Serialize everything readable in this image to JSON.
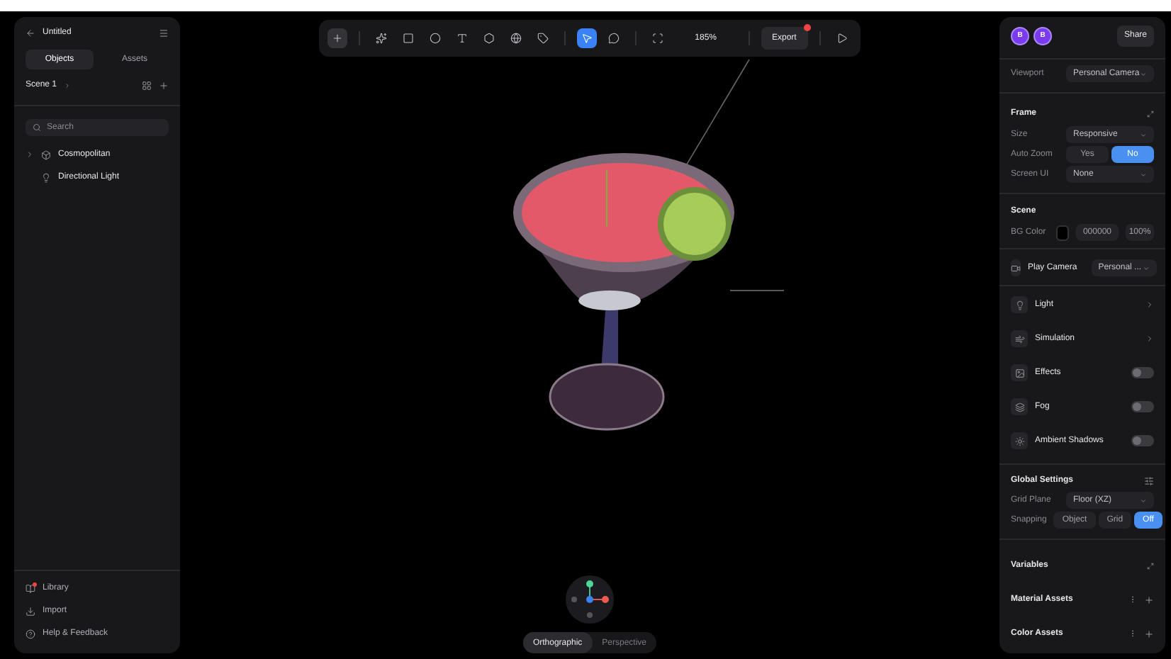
{
  "left_panel": {
    "title": "Untitled",
    "tabs": [
      {
        "label": "Objects",
        "selected": true
      },
      {
        "label": "Assets",
        "selected": false
      }
    ],
    "scene": "Scene 1",
    "search": {
      "placeholder": "Search"
    },
    "tree": [
      {
        "label": "Cosmopolitan",
        "kind": "model"
      },
      {
        "label": "Directional Light",
        "kind": "light"
      }
    ],
    "footer": [
      {
        "label": "Library",
        "kind": "library",
        "badge": true
      },
      {
        "label": "Import",
        "kind": "import",
        "badge": false
      },
      {
        "label": "Help & Feedback",
        "kind": "help",
        "badge": false
      }
    ]
  },
  "toolbar": {
    "tools": [
      {
        "kind": "add",
        "selected": false
      },
      {
        "kind": "component",
        "selected": false
      },
      {
        "kind": "rectangle",
        "selected": false
      },
      {
        "kind": "ellipse",
        "selected": false
      },
      {
        "kind": "text",
        "selected": false
      },
      {
        "kind": "shape3d",
        "selected": false
      },
      {
        "kind": "sphere",
        "selected": false
      },
      {
        "kind": "pen",
        "selected": false
      },
      {
        "kind": "pointer",
        "selected": true
      },
      {
        "kind": "comment",
        "selected": false
      },
      {
        "kind": "frame",
        "selected": false
      }
    ],
    "zoom": "185%",
    "export": {
      "label": "Export",
      "notification": true
    }
  },
  "view_modes": [
    {
      "label": "Orthographic",
      "selected": true
    },
    {
      "label": "Perspective",
      "selected": false
    }
  ],
  "right_panel": {
    "avatars": [
      "B",
      "B"
    ],
    "share": "Share",
    "viewport": {
      "label": "Viewport",
      "value": "Personal Camera"
    },
    "frame": {
      "title": "Frame",
      "size": {
        "label": "Size",
        "value": "Responsive"
      },
      "auto_zoom": {
        "label": "Auto Zoom",
        "options": [
          {
            "label": "Yes",
            "selected": false
          },
          {
            "label": "No",
            "selected": true
          }
        ]
      },
      "screen_ui": {
        "label": "Screen UI",
        "value": "None"
      }
    },
    "scene": {
      "title": "Scene",
      "bg_color": {
        "label": "BG Color",
        "hex": "000000",
        "opacity": "100%"
      }
    },
    "rows": [
      {
        "kind": "select",
        "label": "Play Camera",
        "value": "Personal ..."
      },
      {
        "kind": "link",
        "label": "Light"
      },
      {
        "kind": "link",
        "label": "Simulation"
      },
      {
        "kind": "toggle",
        "label": "Effects",
        "on": false
      },
      {
        "kind": "toggle",
        "label": "Fog",
        "on": false
      },
      {
        "kind": "toggle",
        "label": "Ambient Shadows",
        "on": false
      }
    ],
    "global_settings": {
      "title": "Global Settings",
      "grid_plane": {
        "label": "Grid Plane",
        "value": "Floor (XZ)"
      },
      "snapping": {
        "label": "Snapping",
        "options": [
          {
            "label": "Object",
            "selected": false
          },
          {
            "label": "Grid",
            "selected": false
          },
          {
            "label": "Off",
            "selected": true
          }
        ]
      }
    },
    "sections": [
      {
        "title": "Variables",
        "kind": "expand"
      },
      {
        "title": "Material Assets",
        "kind": "add"
      },
      {
        "title": "Color Assets",
        "kind": "add"
      }
    ]
  }
}
